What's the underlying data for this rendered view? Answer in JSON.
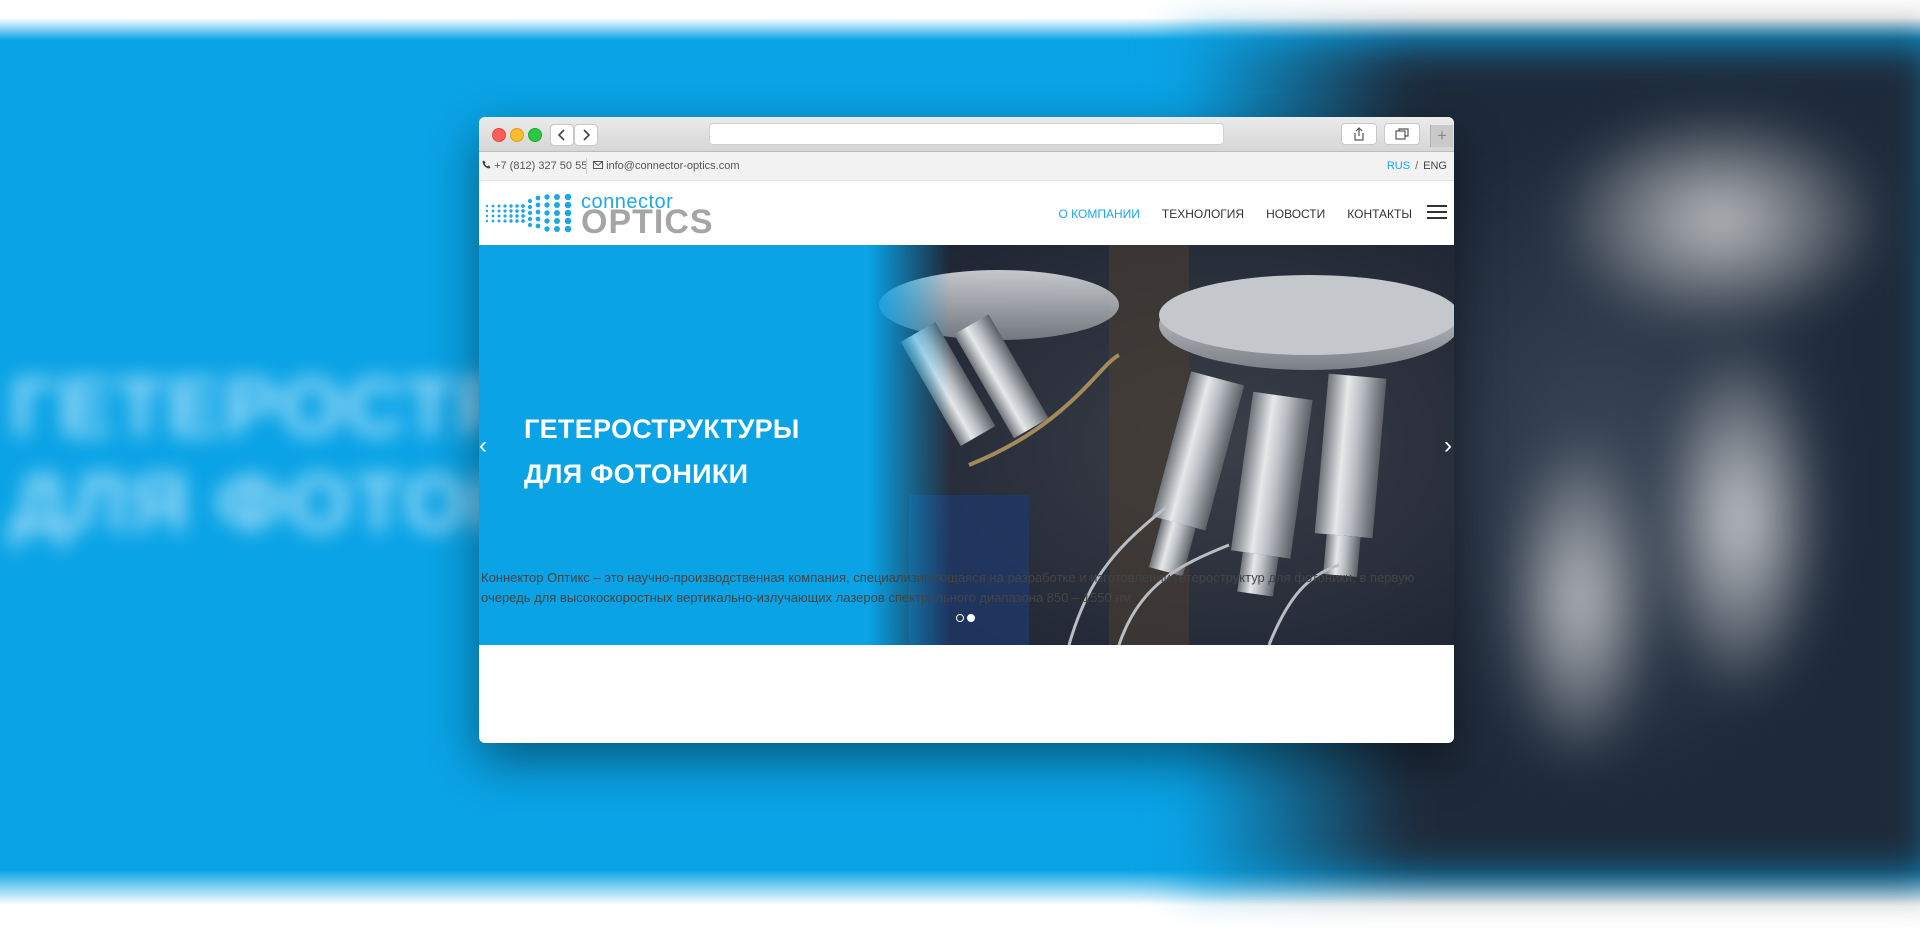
{
  "background": {
    "blurred_title_line1": "ГЕТЕРОСТРУКТУРЫ",
    "blurred_title_line2": "ДЛЯ ФОТОНИКИ",
    "accent_color": "#0aa3e6"
  },
  "browser": {
    "back_icon": "chevron-left-icon",
    "forward_icon": "chevron-right-icon",
    "share_icon": "share-icon",
    "tabs_icon": "tabs-icon",
    "new_tab_label": "+"
  },
  "infobar": {
    "phone": "+7 (812) 327 50 55",
    "email": "info@connector-optics.com",
    "lang_rus": "RUS",
    "lang_separator": "/",
    "lang_eng": "ENG"
  },
  "header": {
    "logo_connector": "connector",
    "logo_optics": "OPTICS",
    "menu": [
      {
        "label": "О КОМПАНИИ",
        "active": true
      },
      {
        "label": "ТЕХНОЛОГИЯ",
        "active": false
      },
      {
        "label": "НОВОСТИ",
        "active": false
      },
      {
        "label": "КОНТАКТЫ",
        "active": false
      }
    ]
  },
  "hero": {
    "title_line1": "ГЕТЕРОСТРУКТУРЫ",
    "title_line2": "ДЛЯ ФОТОНИКИ",
    "prev_label": "‹",
    "next_label": "›",
    "slides_total": 2,
    "active_slide": 2
  },
  "content": {
    "paragraph": "Коннектор Оптикс – это научно-производственная компания, специализирующаяся на разработке и изготовлении гетероструктур для фотоники, в первую очередь для высокоскоростных вертикально-излучающих лазеров спектрального диапазона 850 – 1550 нм."
  }
}
